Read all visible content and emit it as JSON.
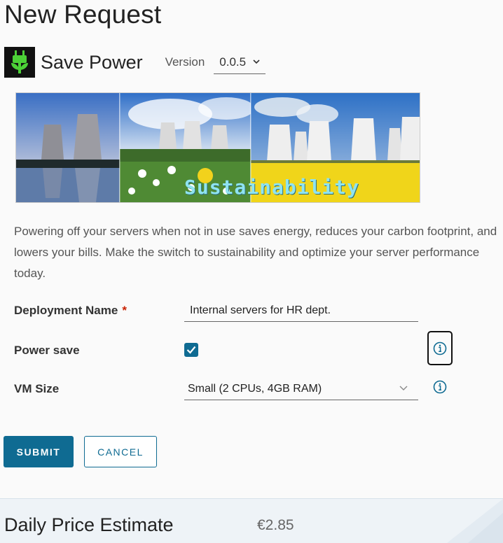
{
  "page": {
    "title": "New Request"
  },
  "catalog": {
    "name": "Save Power",
    "version_label": "Version",
    "version_value": "0.0.5",
    "icon": "power-plug-icon"
  },
  "banner": {
    "caption": "Sustainability"
  },
  "description": "Powering off your servers when not in use saves energy, reduces your carbon footprint, and lowers your bills. Make the switch to sustainability and optimize your server performance today.",
  "form": {
    "deployment_name": {
      "label": "Deployment Name",
      "required_mark": "*",
      "value": "Internal servers for HR dept."
    },
    "power_save": {
      "label": "Power save",
      "checked": true
    },
    "vm_size": {
      "label": "VM Size",
      "value": "Small (2 CPUs, 4GB RAM)"
    }
  },
  "buttons": {
    "submit": "SUBMIT",
    "cancel": "CANCEL"
  },
  "footer": {
    "label": "Daily Price Estimate",
    "value": "€2.85"
  },
  "colors": {
    "primary": "#0f6b92",
    "required": "#c92100",
    "icon_green": "#4cd137"
  }
}
